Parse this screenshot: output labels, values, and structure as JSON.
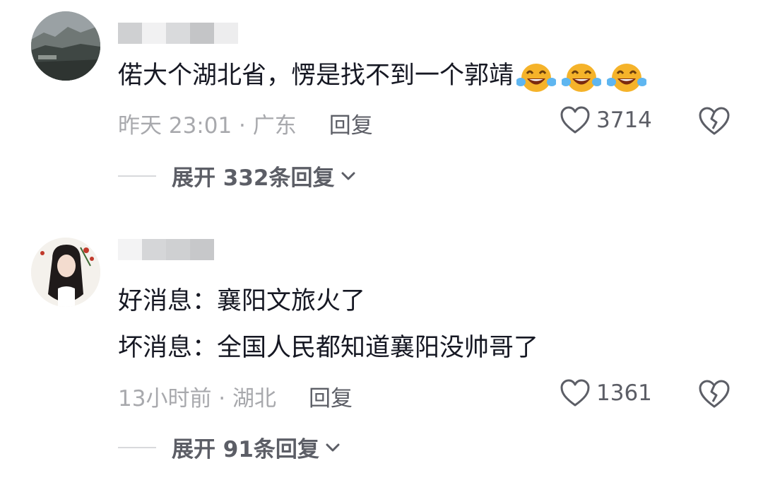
{
  "comments": [
    {
      "lines": [
        "偌大个湖北省，愣是找不到一个郭靖"
      ],
      "emoji": [
        "laughing-crying-emoji",
        "laughing-crying-emoji",
        "laughing-crying-emoji"
      ],
      "meta": "昨天 23:01 · 广东",
      "reply_label": "回复",
      "likes": "3714",
      "expand_label": "展开 332条回复"
    },
    {
      "lines": [
        "好消息：襄阳文旅火了",
        "坏消息：全国人民都知道襄阳没帅哥了"
      ],
      "meta": "13小时前 · 湖北",
      "reply_label": "回复",
      "likes": "1361",
      "expand_label": "展开 91条回复"
    }
  ],
  "colors": {
    "text": "#161823",
    "meta": "#a8a9ad",
    "action": "#5c5e66",
    "emoji_face": "#f5b32a"
  }
}
